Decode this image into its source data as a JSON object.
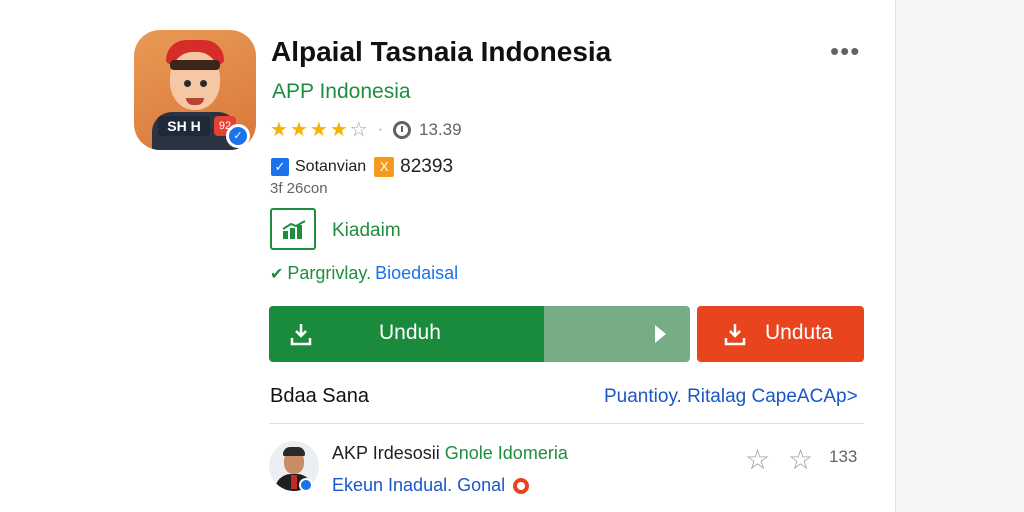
{
  "app": {
    "title": "Alpaial Tasnaia Indonesia",
    "developer": "APP Indonesia",
    "icon_label": "SH H",
    "icon_badge": "92",
    "rating_count": "13.39",
    "rating_value": 4,
    "rating_max": 5
  },
  "meta": {
    "category": "Sotanvian",
    "category_number": "82393",
    "size": "3f 26con"
  },
  "feature": {
    "label": "Kiadaim"
  },
  "privacy": {
    "part1": "Pargrivlay.",
    "part2": "Bioedaisal"
  },
  "buttons": {
    "install_label": "Unduh",
    "secondary_label": "Unduta"
  },
  "section": {
    "title": "Bdaa Sana",
    "link": "Puantioy. Ritalag CapeACAp>"
  },
  "review": {
    "name_part1": "AKP Irdesosii",
    "name_part2": "Gnole",
    "name_part3": "Idomeria",
    "subtitle": "Ekeun Inadual. Gonal",
    "count": "133"
  },
  "colors": {
    "accent_green": "#1a8a3c",
    "accent_red": "#e8441e",
    "link_blue": "#1a57c6"
  },
  "icons": {
    "more": "more-vert-icon",
    "download": "download-icon",
    "play": "play-icon"
  }
}
